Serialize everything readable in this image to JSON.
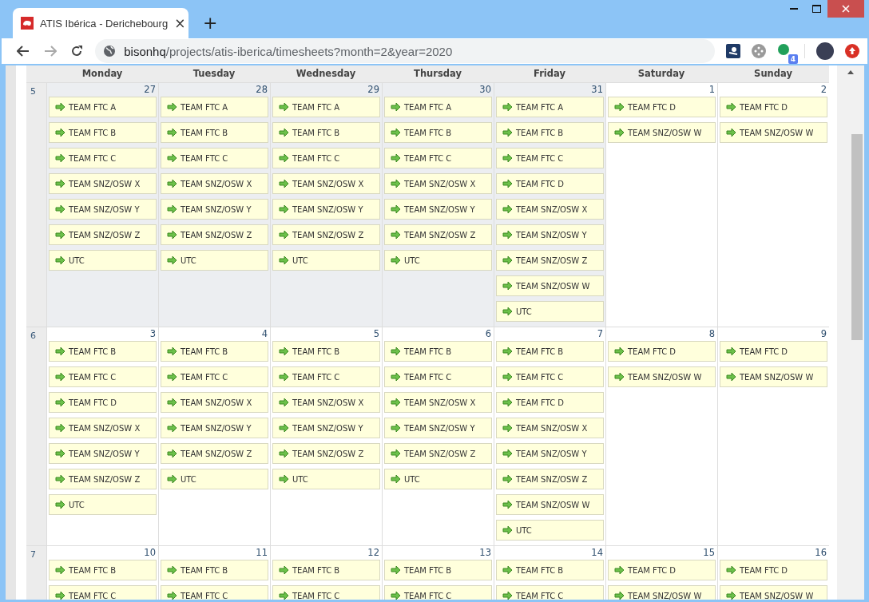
{
  "browser": {
    "tab_title": "ATIS Ibérica - Derichebourg",
    "tab_close": "×",
    "new_tab": "+",
    "url_host": "bisonhq",
    "url_path": "/projects/atis-iberica/timesheets?month=2&year=2020",
    "extension_badge": "4"
  },
  "calendar": {
    "weekdays": [
      "Monday",
      "Tuesday",
      "Wednesday",
      "Thursday",
      "Friday",
      "Saturday",
      "Sunday"
    ],
    "weeks": [
      {
        "number": "5",
        "days": [
          {
            "date": "27",
            "other_month": true,
            "entries": [
              "TEAM FTC A",
              "TEAM FTC B",
              "TEAM FTC C",
              "TEAM SNZ/OSW X",
              "TEAM SNZ/OSW Y",
              "TEAM SNZ/OSW Z",
              "UTC"
            ]
          },
          {
            "date": "28",
            "other_month": true,
            "entries": [
              "TEAM FTC A",
              "TEAM FTC B",
              "TEAM FTC C",
              "TEAM SNZ/OSW X",
              "TEAM SNZ/OSW Y",
              "TEAM SNZ/OSW Z",
              "UTC"
            ]
          },
          {
            "date": "29",
            "other_month": true,
            "entries": [
              "TEAM FTC A",
              "TEAM FTC B",
              "TEAM FTC C",
              "TEAM SNZ/OSW X",
              "TEAM SNZ/OSW Y",
              "TEAM SNZ/OSW Z",
              "UTC"
            ]
          },
          {
            "date": "30",
            "other_month": true,
            "entries": [
              "TEAM FTC A",
              "TEAM FTC B",
              "TEAM FTC C",
              "TEAM SNZ/OSW X",
              "TEAM SNZ/OSW Y",
              "TEAM SNZ/OSW Z",
              "UTC"
            ]
          },
          {
            "date": "31",
            "other_month": true,
            "entries": [
              "TEAM FTC A",
              "TEAM FTC B",
              "TEAM FTC C",
              "TEAM FTC D",
              "TEAM SNZ/OSW X",
              "TEAM SNZ/OSW Y",
              "TEAM SNZ/OSW Z",
              "TEAM SNZ/OSW W",
              "UTC"
            ]
          },
          {
            "date": "1",
            "other_month": false,
            "entries": [
              "TEAM FTC D",
              "TEAM SNZ/OSW W"
            ]
          },
          {
            "date": "2",
            "other_month": false,
            "entries": [
              "TEAM FTC D",
              "TEAM SNZ/OSW W"
            ]
          }
        ]
      },
      {
        "number": "6",
        "days": [
          {
            "date": "3",
            "other_month": false,
            "entries": [
              "TEAM FTC B",
              "TEAM FTC C",
              "TEAM FTC D",
              "TEAM SNZ/OSW X",
              "TEAM SNZ/OSW Y",
              "TEAM SNZ/OSW Z",
              "UTC"
            ]
          },
          {
            "date": "4",
            "other_month": false,
            "entries": [
              "TEAM FTC B",
              "TEAM FTC C",
              "TEAM SNZ/OSW X",
              "TEAM SNZ/OSW Y",
              "TEAM SNZ/OSW Z",
              "UTC"
            ]
          },
          {
            "date": "5",
            "other_month": false,
            "entries": [
              "TEAM FTC B",
              "TEAM FTC C",
              "TEAM SNZ/OSW X",
              "TEAM SNZ/OSW Y",
              "TEAM SNZ/OSW Z",
              "UTC"
            ]
          },
          {
            "date": "6",
            "other_month": false,
            "entries": [
              "TEAM FTC B",
              "TEAM FTC C",
              "TEAM SNZ/OSW X",
              "TEAM SNZ/OSW Y",
              "TEAM SNZ/OSW Z",
              "UTC"
            ]
          },
          {
            "date": "7",
            "other_month": false,
            "entries": [
              "TEAM FTC B",
              "TEAM FTC C",
              "TEAM FTC D",
              "TEAM SNZ/OSW X",
              "TEAM SNZ/OSW Y",
              "TEAM SNZ/OSW Z",
              "TEAM SNZ/OSW W",
              "UTC"
            ]
          },
          {
            "date": "8",
            "other_month": false,
            "entries": [
              "TEAM FTC D",
              "TEAM SNZ/OSW W"
            ]
          },
          {
            "date": "9",
            "other_month": false,
            "entries": [
              "TEAM FTC D",
              "TEAM SNZ/OSW W"
            ]
          }
        ]
      },
      {
        "number": "7",
        "days": [
          {
            "date": "10",
            "other_month": false,
            "entries": [
              "TEAM FTC B",
              "TEAM FTC C"
            ]
          },
          {
            "date": "11",
            "other_month": false,
            "entries": [
              "TEAM FTC B",
              "TEAM FTC C"
            ]
          },
          {
            "date": "12",
            "other_month": false,
            "entries": [
              "TEAM FTC B",
              "TEAM FTC C"
            ]
          },
          {
            "date": "13",
            "other_month": false,
            "entries": [
              "TEAM FTC B",
              "TEAM FTC C"
            ]
          },
          {
            "date": "14",
            "other_month": false,
            "entries": [
              "TEAM FTC B",
              "TEAM FTC C"
            ]
          },
          {
            "date": "15",
            "other_month": false,
            "entries": [
              "TEAM FTC D",
              "TEAM SNZ/OSW W"
            ]
          },
          {
            "date": "16",
            "other_month": false,
            "entries": [
              "TEAM FTC D",
              "TEAM SNZ/OSW W"
            ]
          }
        ]
      }
    ]
  }
}
